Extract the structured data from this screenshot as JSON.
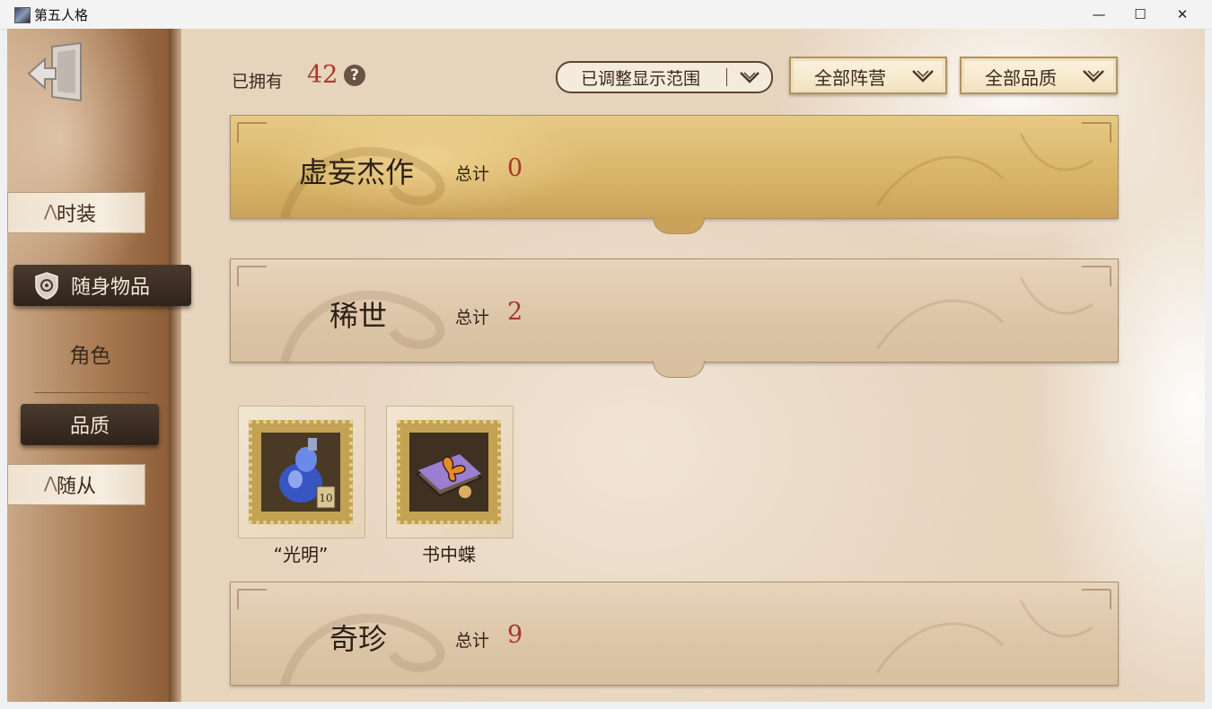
{
  "window": {
    "title": "第五人格",
    "minimize_symbol": "—",
    "maximize_symbol": "☐",
    "close_symbol": "✕"
  },
  "sidebar": {
    "tabs": [
      {
        "label": "时装",
        "icon": "tab-mark-icon"
      },
      {
        "label": "随身物品",
        "icon": "shield-icon",
        "active": true
      },
      {
        "label": "随从",
        "icon": "tab-mark-icon"
      }
    ],
    "role_label": "角色",
    "quality_label": "品质"
  },
  "header": {
    "owned_label": "已拥有",
    "owned_count": "42",
    "help_symbol": "?",
    "range_button": "已调整显示范围",
    "faction_filter": "全部阵营",
    "quality_filter": "全部品质"
  },
  "categories": [
    {
      "name": "虚妄杰作",
      "total_label": "总计",
      "total": "0",
      "style": "gold"
    },
    {
      "name": "稀世",
      "total_label": "总计",
      "total": "2",
      "style": "plain"
    },
    {
      "name": "奇珍",
      "total_label": "总计",
      "total": "9",
      "style": "plain"
    }
  ],
  "items": [
    {
      "name": "“光明”",
      "badge": "10",
      "icon": "potion-icon"
    },
    {
      "name": "书中蝶",
      "icon": "butterfly-book-icon"
    }
  ],
  "colors": {
    "accent_red": "#a8372b",
    "gold_banner": "#d8b468",
    "dark_tab": "#2f241c"
  }
}
